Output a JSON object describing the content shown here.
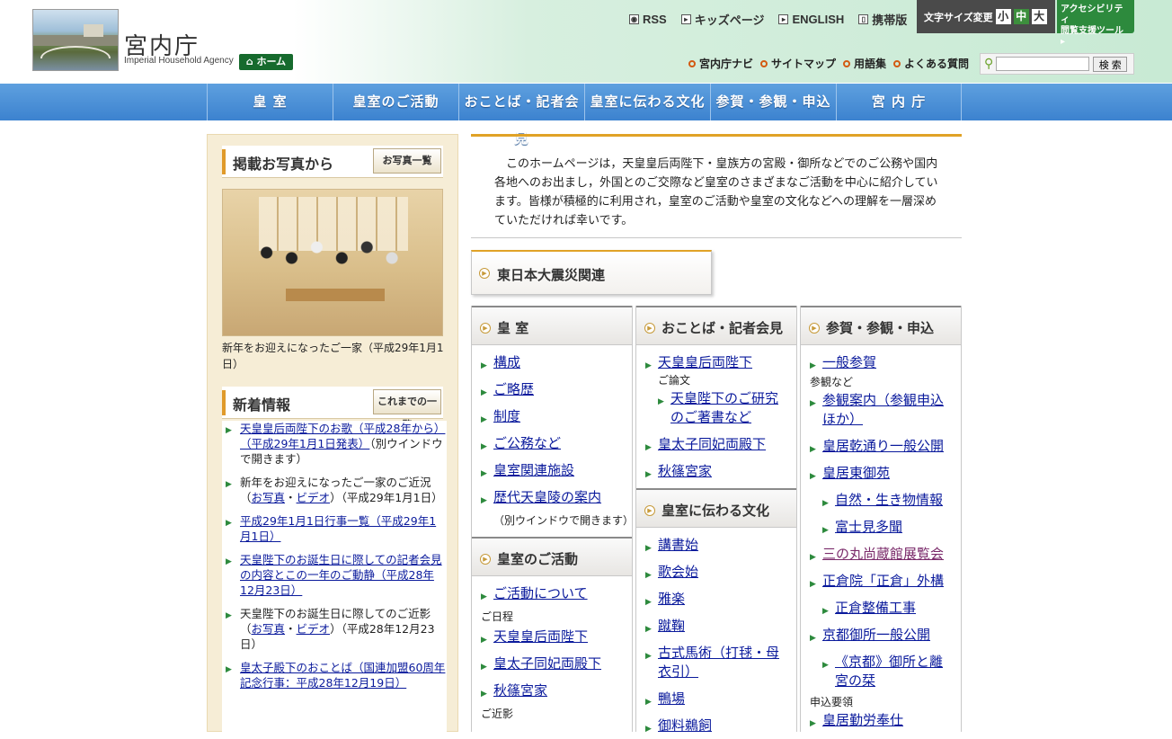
{
  "header": {
    "logo_name": "宮内庁",
    "logo_sub": "Imperial Household Agency",
    "home_label": "ホーム",
    "top_links": [
      {
        "label": "RSS",
        "icon": "rss-icon"
      },
      {
        "label": "キッズページ",
        "icon": "arrow-box-icon"
      },
      {
        "label": "ENGLISH",
        "icon": "arrow-box-icon"
      },
      {
        "label": "携帯版",
        "icon": "mobile-icon"
      }
    ],
    "fontsize_label": "文字サイズ変更",
    "fontsize_small": "小",
    "fontsize_mid": "中",
    "fontsize_large": "大",
    "access_line1": "アクセシビリティ",
    "access_line2": "閲覧支援ツール",
    "subnav": [
      "宮内庁ナビ",
      "サイトマップ",
      "用語集",
      "よくある質問"
    ],
    "search_button": "検 索"
  },
  "mainnav": [
    "皇 室",
    "皇室のご活動",
    "おことば・記者会見",
    "皇室に伝わる文化",
    "参賀・参観・申込",
    "宮 内 庁"
  ],
  "left": {
    "photo_title": "掲載お写真から",
    "photo_button": "お写真一覧",
    "photo_caption": "新年をお迎えになったご一家（平成29年1月1日）",
    "news_title": "新着情報",
    "news_button": "これまでの一覧",
    "news": [
      {
        "link": "天皇皇后両陛下のお歌（平成28年から）（平成29年1月1日発表）",
        "tail": "（別ウインドウで開きます）"
      },
      {
        "pre": "新年をお迎えになったご一家のご近況（",
        "link1": "お写真",
        "mid": "・",
        "link2": "ビデオ",
        "tail": "）（平成29年1月1日）"
      },
      {
        "link": "平成29年1月1日行事一覧（平成29年1月1日）",
        "tail": ""
      },
      {
        "link": "天皇陛下のお誕生日に際しての記者会見の内容とこの一年のご動静（平成28年12月23日）",
        "tail": ""
      },
      {
        "pre": "天皇陛下のお誕生日に際してのご近影（",
        "link1": "お写真",
        "mid": "・",
        "link2": "ビデオ",
        "tail": "）（平成28年12月23日）"
      },
      {
        "link": "皇太子殿下のおことば（国連加盟60周年記念行事：平成28年12月19日）",
        "tail": ""
      }
    ]
  },
  "intro": "このホームページは，天皇皇后両陛下・皇族方の宮殿・御所などでのご公務や国内各地へのお出まし，外国とのご交際など皇室のさまざまなご活動を中心に紹介しています。皆様が積極的に利用され，皇室のご活動や皇室の文化などへの理解を一層深めていただければ幸いです。",
  "disaster": "東日本大震災関連",
  "col1": {
    "title": "皇 室",
    "links": [
      "構成",
      "ご略歴",
      "制度",
      "ご公務など",
      "皇室関連施設",
      "歴代天皇陵の案内"
    ],
    "note": "（別ウインドウで開きます）",
    "title2": "皇室のご活動",
    "links2": [
      "ご活動について"
    ],
    "note2": "ご日程",
    "links3": [
      "天皇皇后両陛下",
      "皇太子同妃両殿下",
      "秋篠宮家"
    ],
    "note3": "ご近影"
  },
  "col2": {
    "title": "おことば・記者会見",
    "link1": "天皇皇后両陛下",
    "note": "ご論文",
    "sublink": "天皇陛下のご研究のご著書など",
    "links": [
      "皇太子同妃両殿下",
      "秋篠宮家"
    ],
    "title2": "皇室に伝わる文化",
    "links2": [
      "講書始",
      "歌会始",
      "雅楽",
      "蹴鞠",
      "古式馬術（打毬・母衣引）",
      "鴨場",
      "御料鵜飼"
    ]
  },
  "col3": {
    "title": "参賀・参観・申込",
    "link1": "一般参賀",
    "note": "参観など",
    "links": [
      "参観案内（参観申込ほか）",
      "皇居乾通り一般公開",
      "皇居東御苑"
    ],
    "sublinks": [
      "自然・生き物情報",
      "富士見多聞"
    ],
    "visited": "三の丸尚蔵館展覧会",
    "link_shoso": "正倉院「正倉」外構",
    "sub_shoso": "正倉整備工事",
    "link_kyoto": "京都御所一般公開",
    "sub_kyoto": "《京都》御所と離宮の栞",
    "note2": "申込要領",
    "last": "皇居勤労奉仕"
  }
}
